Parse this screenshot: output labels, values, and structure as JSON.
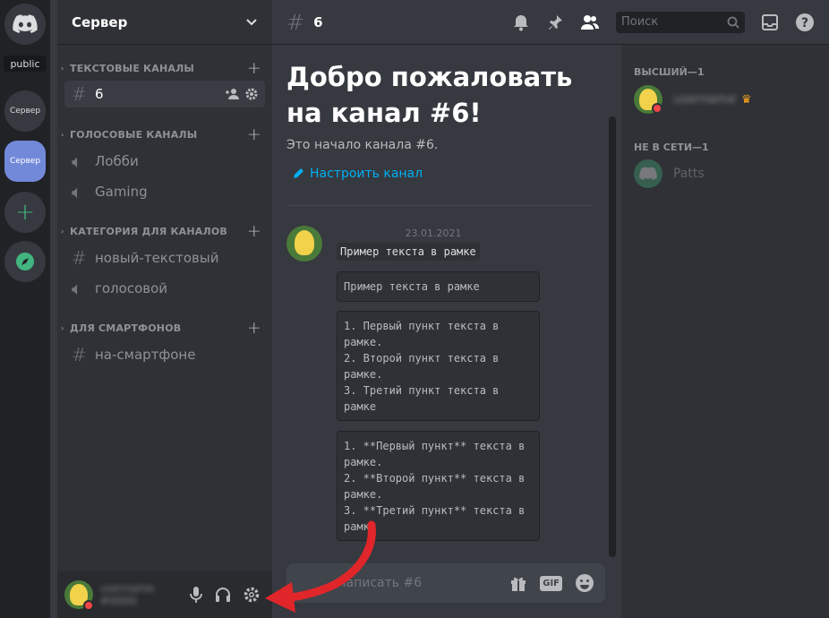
{
  "rail": {
    "tooltip": "public",
    "servers": [
      "Сервер",
      "Сервер"
    ]
  },
  "server": {
    "name": "Сервер",
    "categories": [
      {
        "label": "ТЕКСТОВЫЕ КАНАЛЫ"
      },
      {
        "label": "ГОЛОСОВЫЕ КАНАЛЫ"
      },
      {
        "label": "КАТЕГОРИЯ ДЛЯ КАНАЛОВ"
      },
      {
        "label": "ДЛЯ СМАРТФОНОВ"
      }
    ],
    "channels": [
      {
        "label": "6",
        "type": "text"
      },
      {
        "label": "Лобби",
        "type": "voice"
      },
      {
        "label": "Gaming",
        "type": "voice"
      },
      {
        "label": "новый-текстовый",
        "type": "text"
      },
      {
        "label": "голосовой",
        "type": "voice"
      },
      {
        "label": "на-смартфоне",
        "type": "text"
      }
    ]
  },
  "user": {
    "name": "username",
    "tag": "#0000"
  },
  "topbar": {
    "channel": "6",
    "search_placeholder": "Поиск"
  },
  "welcome": {
    "title": "Добро пожаловать на канал #6!",
    "subtitle": "Это начало канала #6.",
    "configure": "Настроить канал"
  },
  "message": {
    "date": "23.01.2021",
    "inline": "Пример текста в рамке",
    "blocks": [
      "Пример текста в рамке",
      "1. Первый пункт текста в рамке.\n2. Второй пункт текста в рамке.\n3. Третий пункт текста в рамке",
      "1. **Первый пункт** текста в рамке.\n2. **Второй пункт** текста в рамке.\n3. **Третий пункт** текста в рамке"
    ]
  },
  "composer": {
    "placeholder": "Написать #6",
    "gif": "GIF"
  },
  "members": {
    "cat_top": "ВЫСШИЙ—1",
    "cat_offline": "НЕ В СЕТИ—1",
    "top_member": "username",
    "offline_member": "Patts"
  },
  "colors": {
    "accent": "#7289da",
    "link": "#00b0f4",
    "online_add": "#43b581",
    "dnd": "#f04747",
    "arrow": "#e0262a"
  }
}
